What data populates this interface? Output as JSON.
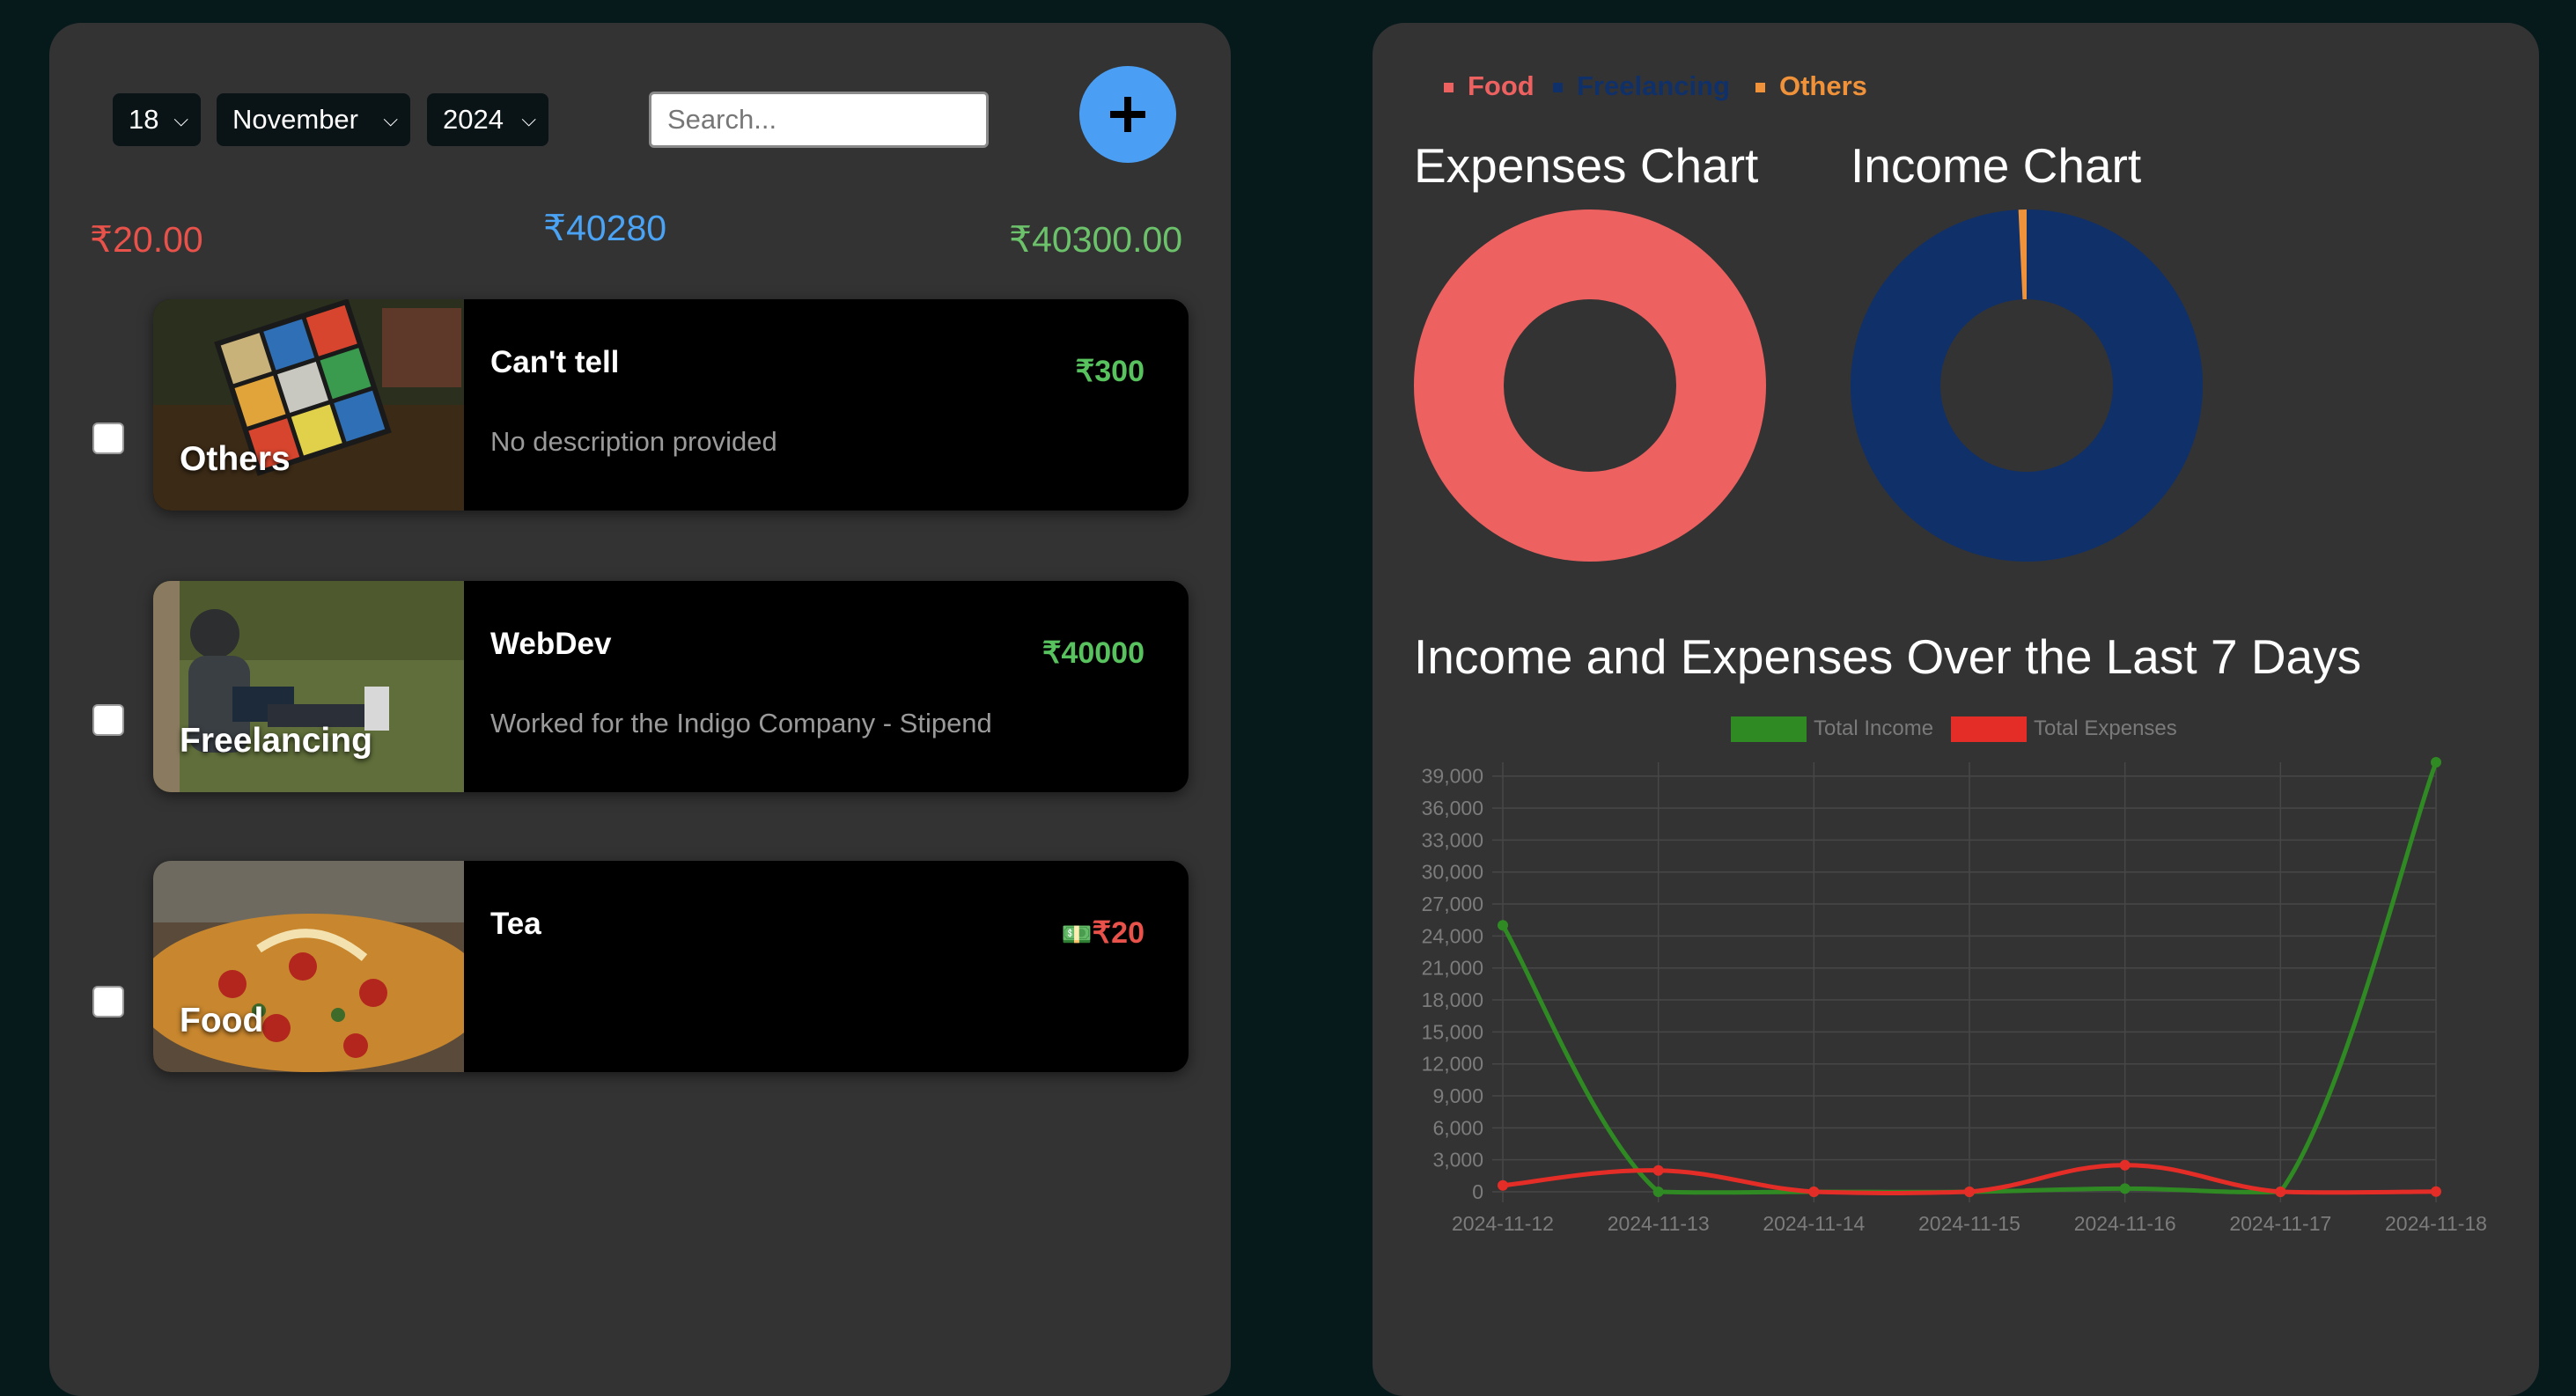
{
  "filters": {
    "day": "18",
    "month": "November",
    "year": "2024",
    "search_placeholder": "Search..."
  },
  "summary": {
    "expense_total": "₹20.00",
    "balance": "₹40280",
    "income_total": "₹40300.00"
  },
  "transactions": [
    {
      "category": "Others",
      "title": "Can't tell",
      "description": "No description provided",
      "amount": "₹300",
      "type": "income"
    },
    {
      "category": "Freelancing",
      "title": "WebDev",
      "description": "Worked for the Indigo Company - Stipend",
      "amount": "₹40000",
      "type": "income"
    },
    {
      "category": "Food",
      "title": "Tea",
      "description": "",
      "amount": "₹20",
      "amount_icon": "💵",
      "type": "expense"
    }
  ],
  "legend": [
    {
      "label": "Food",
      "color": "#ee6161"
    },
    {
      "label": "Freelancing",
      "color": "#10306a"
    },
    {
      "label": "Others",
      "color": "#f0923a"
    }
  ],
  "chart_titles": {
    "expenses": "Expenses Chart",
    "income": "Income Chart",
    "line": "Income and Expenses Over the Last 7 Days"
  },
  "chart_data": [
    {
      "type": "pie",
      "title": "Expenses Chart",
      "categories": [
        "Food"
      ],
      "values": [
        20
      ],
      "colors": [
        "#ee6161"
      ]
    },
    {
      "type": "pie",
      "title": "Income Chart",
      "categories": [
        "Freelancing",
        "Others"
      ],
      "values": [
        40000,
        300
      ],
      "colors": [
        "#10306a",
        "#f0923a"
      ]
    },
    {
      "type": "line",
      "title": "Income and Expenses Over the Last 7 Days",
      "x": [
        "2024-11-12",
        "2024-11-13",
        "2024-11-14",
        "2024-11-15",
        "2024-11-16",
        "2024-11-17",
        "2024-11-18"
      ],
      "series": [
        {
          "name": "Total Income",
          "color": "#2f8a23",
          "values": [
            25000,
            0,
            0,
            0,
            300,
            0,
            40300
          ]
        },
        {
          "name": "Total Expenses",
          "color": "#e52d27",
          "values": [
            600,
            2000,
            0,
            0,
            2500,
            0,
            20
          ]
        }
      ],
      "yticks": [
        "39,000",
        "36,000",
        "33,000",
        "30,000",
        "27,000",
        "24,000",
        "21,000",
        "18,000",
        "15,000",
        "12,000",
        "9,000",
        "6,000",
        "3,000",
        "0"
      ],
      "ylim": [
        0,
        40300
      ],
      "grid": true,
      "legend_position": "top"
    }
  ]
}
